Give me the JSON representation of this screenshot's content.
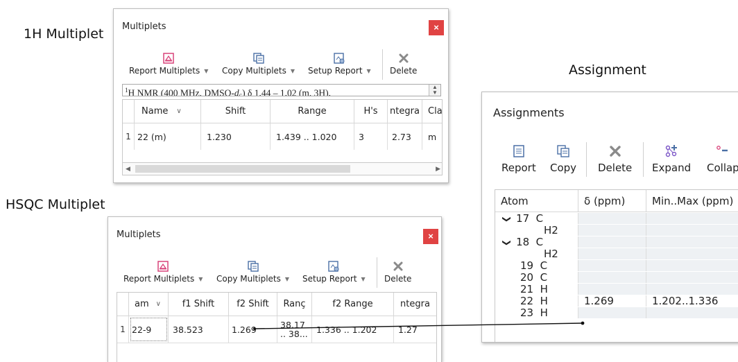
{
  "labels": {
    "h1_multiplet": "1H Multiplet",
    "hsqc_multiplet": "HSQC Multiplet",
    "assignment": "Assignment"
  },
  "multiplets_1h": {
    "title": "Multiplets",
    "close": "×",
    "toolbar": {
      "report": "Report Multiplets",
      "copy": "Copy Multiplets",
      "setup": "Setup Report",
      "delete": "Delete"
    },
    "report_text": {
      "sup": "1",
      "pre": "H NMR (400 MHz, DMSO-",
      "d": "d",
      "d_sub": "6",
      "post": ") δ 1.44 – 1.02 (m, 3H)."
    },
    "columns": [
      "Name",
      "Shift",
      "Range",
      "H's",
      "ntegra",
      "Cla"
    ],
    "rows": [
      {
        "num": "1",
        "name": "22 (m)",
        "shift": "1.230",
        "range": "1.439 .. 1.020",
        "hs": "3",
        "integral": "2.73",
        "class": "m"
      }
    ]
  },
  "multiplets_hsqc": {
    "title": "Multiplets",
    "close": "×",
    "toolbar": {
      "report": "Report Multiplets",
      "copy": "Copy Multiplets",
      "setup": "Setup Report",
      "delete": "Delete"
    },
    "columns": [
      "am",
      "f1 Shift",
      "f2 Shift",
      "Ranç",
      "f2 Range",
      "ntegra"
    ],
    "rows": [
      {
        "num": "1",
        "name": "22-9",
        "f1_shift": "38.523",
        "f2_shift": "1.269",
        "f1_range_1": "38.17",
        "f1_range_2": ".. 38...",
        "f2_range": "1.336 .. 1.202",
        "integral": "1.27"
      }
    ]
  },
  "assignments": {
    "title": "Assignments",
    "toolbar": {
      "report": "Report",
      "copy": "Copy",
      "delete": "Delete",
      "expand": "Expand",
      "collapse": "Collap"
    },
    "columns": [
      "Atom",
      "δ (ppm)",
      "Min..Max (ppm)"
    ],
    "rows": [
      {
        "chevron": "❯",
        "atom": "17  C",
        "shift": "",
        "range": ""
      },
      {
        "chevron": "",
        "atom": "H2",
        "shift": "",
        "range": ""
      },
      {
        "chevron": "❯",
        "atom": "18  C",
        "shift": "",
        "range": ""
      },
      {
        "chevron": "",
        "atom": "H2",
        "shift": "",
        "range": ""
      },
      {
        "chevron": "",
        "atom": "19  C",
        "shift": "",
        "range": ""
      },
      {
        "chevron": "",
        "atom": "20  C",
        "shift": "",
        "range": ""
      },
      {
        "chevron": "",
        "atom": "21  H",
        "shift": "",
        "range": ""
      },
      {
        "chevron": "",
        "atom": "22  H",
        "shift": "1.269",
        "range": "1.202..1.336"
      },
      {
        "chevron": "",
        "atom": "23  H",
        "shift": "",
        "range": ""
      }
    ]
  },
  "colors": {
    "close_red": "#e04343",
    "icon_pink": "#d9437a",
    "icon_blue": "#4a6fa5",
    "icon_purple": "#7b55c7",
    "row_shade": "#eef1f4"
  }
}
